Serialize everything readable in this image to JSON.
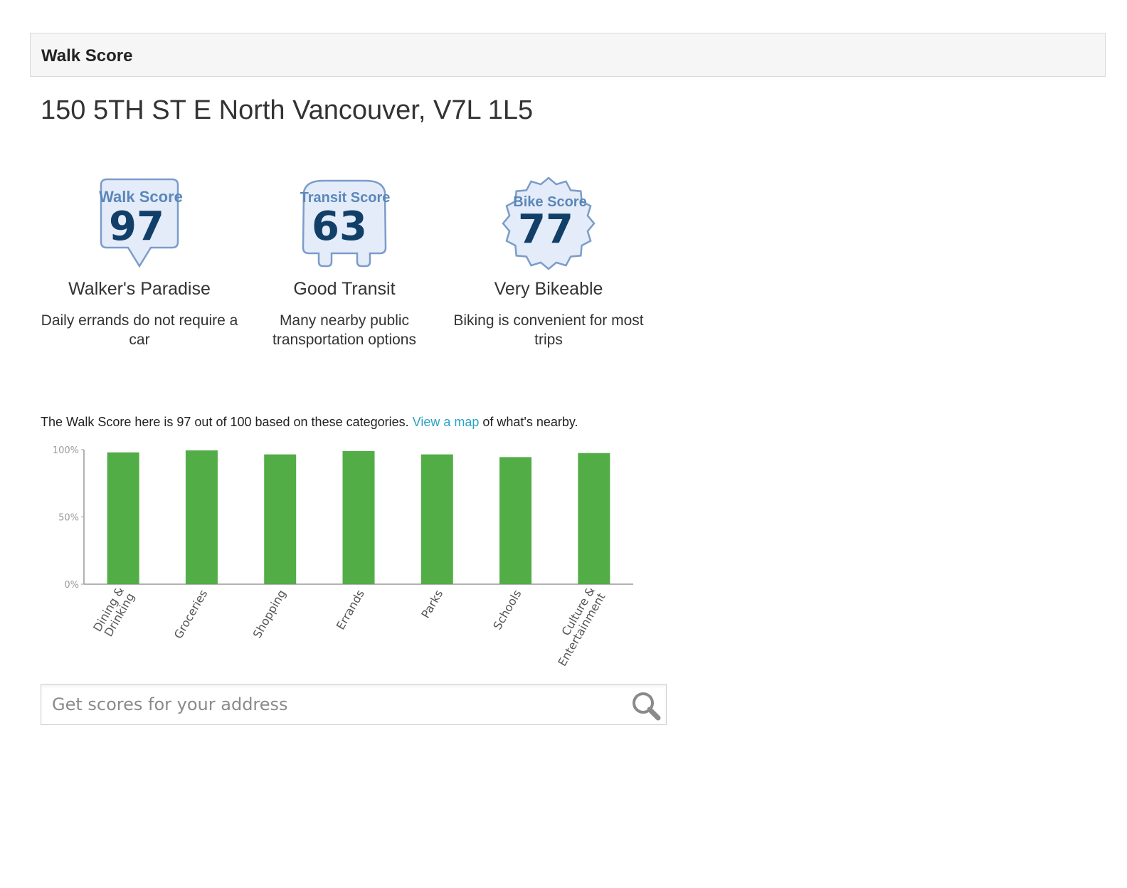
{
  "panel": {
    "title": "Walk Score"
  },
  "address": "150 5TH ST E North Vancouver, V7L 1L5",
  "scores": [
    {
      "badge_title": "Walk Score",
      "value": "97",
      "label": "Walker's Paradise",
      "desc_line1": "Daily errands do not require a",
      "desc_line2": "car",
      "icon": "speech-bubble-badge"
    },
    {
      "badge_title": "Transit Score",
      "value": "63",
      "label": "Good Transit",
      "desc_line1": "Many nearby public",
      "desc_line2": "transportation options",
      "icon": "bus-badge"
    },
    {
      "badge_title": "Bike Score",
      "value": "77",
      "label": "Very Bikeable",
      "desc_line1": "Biking is convenient for most",
      "desc_line2": "trips",
      "icon": "gear-badge"
    }
  ],
  "summary": {
    "before": "The Walk Score here is 97 out of 100 based on these categories. ",
    "link": "View a map",
    "after": " of what's nearby."
  },
  "colors": {
    "bar": "#52ad47",
    "link": "#2aa4c6",
    "badge_fill": "#e4ecfa",
    "badge_stroke": "#7c9cc9",
    "badge_number": "#123f68"
  },
  "chart_data": {
    "type": "bar",
    "categories": [
      [
        "Dining &",
        "Drinking"
      ],
      [
        "Groceries"
      ],
      [
        "Shopping"
      ],
      [
        "Errands"
      ],
      [
        "Parks"
      ],
      [
        "Schools"
      ],
      [
        "Culture &",
        "Entertainment"
      ]
    ],
    "values": [
      98,
      99.5,
      96.5,
      99,
      96.5,
      94.5,
      97.5
    ],
    "yticks": [
      "100%",
      "50%",
      "0%"
    ],
    "ylim": [
      0,
      100
    ],
    "grid": false
  },
  "search": {
    "placeholder": "Get scores for your address",
    "icon": "magnifier-icon"
  }
}
